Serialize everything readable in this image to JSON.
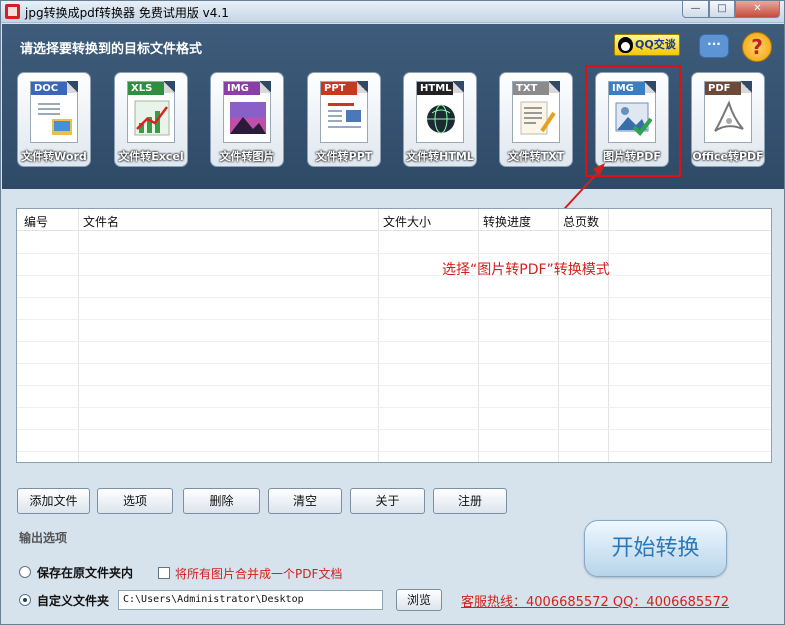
{
  "window": {
    "title": "jpg转换成pdf转换器 免费试用版 v4.1",
    "min": "—",
    "max": "□",
    "close": "✕"
  },
  "header": {
    "prompt": "请选择要转换到的目标文件格式",
    "qq_label": "QQ交谈"
  },
  "modes": [
    {
      "tag": "DOC",
      "label": "文件转Word",
      "color": "#3b67b8"
    },
    {
      "tag": "XLS",
      "label": "文件转Excel",
      "color": "#2f8f3f"
    },
    {
      "tag": "IMG",
      "label": "文件转图片",
      "color": "#8a3fa6"
    },
    {
      "tag": "PPT",
      "label": "文件转PPT",
      "color": "#c9381e"
    },
    {
      "tag": "HTML",
      "label": "文件转HTML",
      "color": "#222222"
    },
    {
      "tag": "TXT",
      "label": "文件转TXT",
      "color": "#8b8b8b"
    },
    {
      "tag": "IMG",
      "label": "图片转PDF",
      "color": "#3a7fc4",
      "selected": true
    },
    {
      "tag": "PDF",
      "label": "Office转PDF",
      "color": "#6b4a3a"
    }
  ],
  "table": {
    "columns": [
      "编号",
      "文件名",
      "文件大小",
      "转换进度",
      "总页数"
    ],
    "rows": []
  },
  "annotation": "选择“图片转PDF”转换模式",
  "toolbar": {
    "add": "添加文件",
    "options": "选项",
    "delete": "删除",
    "clear": "清空",
    "about": "关于",
    "register": "注册"
  },
  "output": {
    "section_label": "输出选项",
    "keep_original": "保存在原文件夹内",
    "merge_label": "将所有图片合并成一个PDF文档",
    "custom_folder": "自定义文件夹",
    "path": "C:\\Users\\Administrator\\Desktop",
    "browse": "浏览",
    "selected": "custom"
  },
  "hotline": "客服热线：4006685572 QQ：4006685572",
  "start_button": "开始转换"
}
